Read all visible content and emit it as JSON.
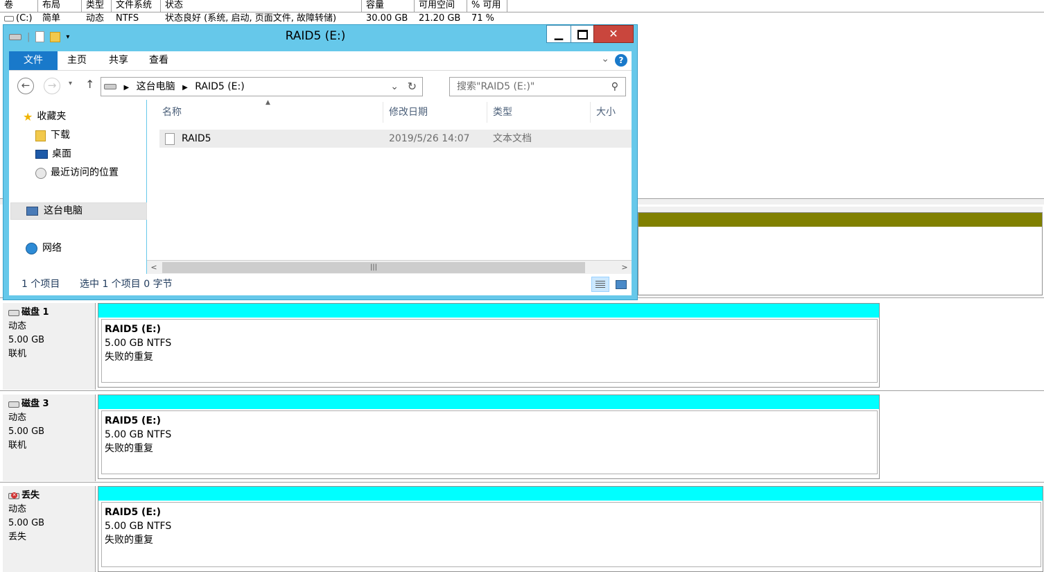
{
  "volume_list": {
    "headers": [
      "卷",
      "布局",
      "类型",
      "文件系统",
      "状态",
      "容量",
      "可用空间",
      "% 可用"
    ],
    "row": {
      "volume": "(C:)",
      "layout": "简单",
      "type": "动态",
      "fs": "NTFS",
      "status": "状态良好 (系统, 启动, 页面文件, 故障转储)",
      "capacity": "30.00 GB",
      "free": "21.20 GB",
      "pct": "71 %"
    }
  },
  "colors": {
    "olive_bar": "#808000",
    "cyan_bar": "#00ffff",
    "explorer_frame": "#66c8ea",
    "accent": "#1979ca",
    "close_red": "#c9463d"
  },
  "disks": [
    {
      "title": "磁盘 1",
      "type": "动态",
      "size": "5.00 GB",
      "state": "联机",
      "icon": "disk-icon",
      "partition": {
        "name": "RAID5  (E:)",
        "detail": "5.00 GB NTFS",
        "status": "失败的重复"
      }
    },
    {
      "title": "磁盘 3",
      "type": "动态",
      "size": "5.00 GB",
      "state": "联机",
      "icon": "disk-icon",
      "partition": {
        "name": "RAID5  (E:)",
        "detail": "5.00 GB NTFS",
        "status": "失败的重复"
      }
    },
    {
      "title": "丢失",
      "type": "动态",
      "size": "5.00 GB",
      "state": "丢失",
      "icon": "missing-disk-icon",
      "partition": {
        "name": "RAID5  (E:)",
        "detail": "5.00 GB NTFS",
        "status": "失败的重复"
      }
    }
  ],
  "explorer": {
    "title": "RAID5 (E:)",
    "ribbon_tabs": [
      "文件",
      "主页",
      "共享",
      "查看"
    ],
    "breadcrumb": [
      "这台电脑",
      "RAID5 (E:)"
    ],
    "search_placeholder": "搜索\"RAID5 (E:)\"",
    "nav": {
      "favorites": "收藏夹",
      "downloads": "下载",
      "desktop": "桌面",
      "recent": "最近访问的位置",
      "this_pc": "这台电脑",
      "network": "网络"
    },
    "columns": [
      "名称",
      "修改日期",
      "类型",
      "大小"
    ],
    "files": [
      {
        "name": "RAID5",
        "modified": "2019/5/26 14:07",
        "type": "文本文档"
      }
    ],
    "status": {
      "count": "1 个项目",
      "selected": "选中 1 个项目  0 字节"
    }
  }
}
